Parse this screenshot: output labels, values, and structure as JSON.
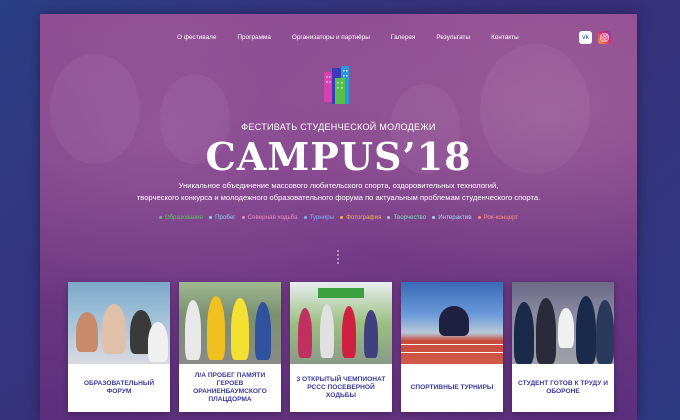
{
  "nav": {
    "items": [
      "О фестивале",
      "Программа",
      "Организаторы и партнёры",
      "Галерея",
      "Результаты",
      "Контакты"
    ]
  },
  "social": {
    "vk_label": "VK",
    "ig_label": "IG"
  },
  "hero": {
    "subtitle": "ФЕСТИВАТЬ СТУДЕНЧЕСКОЙ МОЛОДЕЖИ",
    "title": "CAMPUS’18",
    "description_line1": "Уникальное объединение массового любительского спорта, оздоровительных технологий,",
    "description_line2": "творческого конкурса и молодежного образовательного форума по актуальным проблемам студенческого спорта."
  },
  "tags": [
    {
      "label": "Образование",
      "color": "#5cc06a"
    },
    {
      "label": "Пробег",
      "color": "#8fd0ff"
    },
    {
      "label": "Северная ходьба",
      "color": "#f08ac0"
    },
    {
      "label": "Турниры",
      "color": "#7fb0ff"
    },
    {
      "label": "Фотография",
      "color": "#f5b04a"
    },
    {
      "label": "Творчество",
      "color": "#7ee0c0"
    },
    {
      "label": "Интерактив",
      "color": "#a0d8f0"
    },
    {
      "label": "Рок-концерт",
      "color": "#ff8a8a"
    }
  ],
  "cards": [
    {
      "label": "Образовательный форум"
    },
    {
      "label": "л/а пробег памяти героев ораниенбаумского плацдорма"
    },
    {
      "label": "3 открытый чемпионат РССС посеверной ходьбы"
    },
    {
      "label": "Спортивные турниры"
    },
    {
      "label": "Студент готов к труду и обороне"
    }
  ],
  "colors": {
    "accent": "#3a3a9a",
    "hero_bg": "#7c3f8a"
  }
}
